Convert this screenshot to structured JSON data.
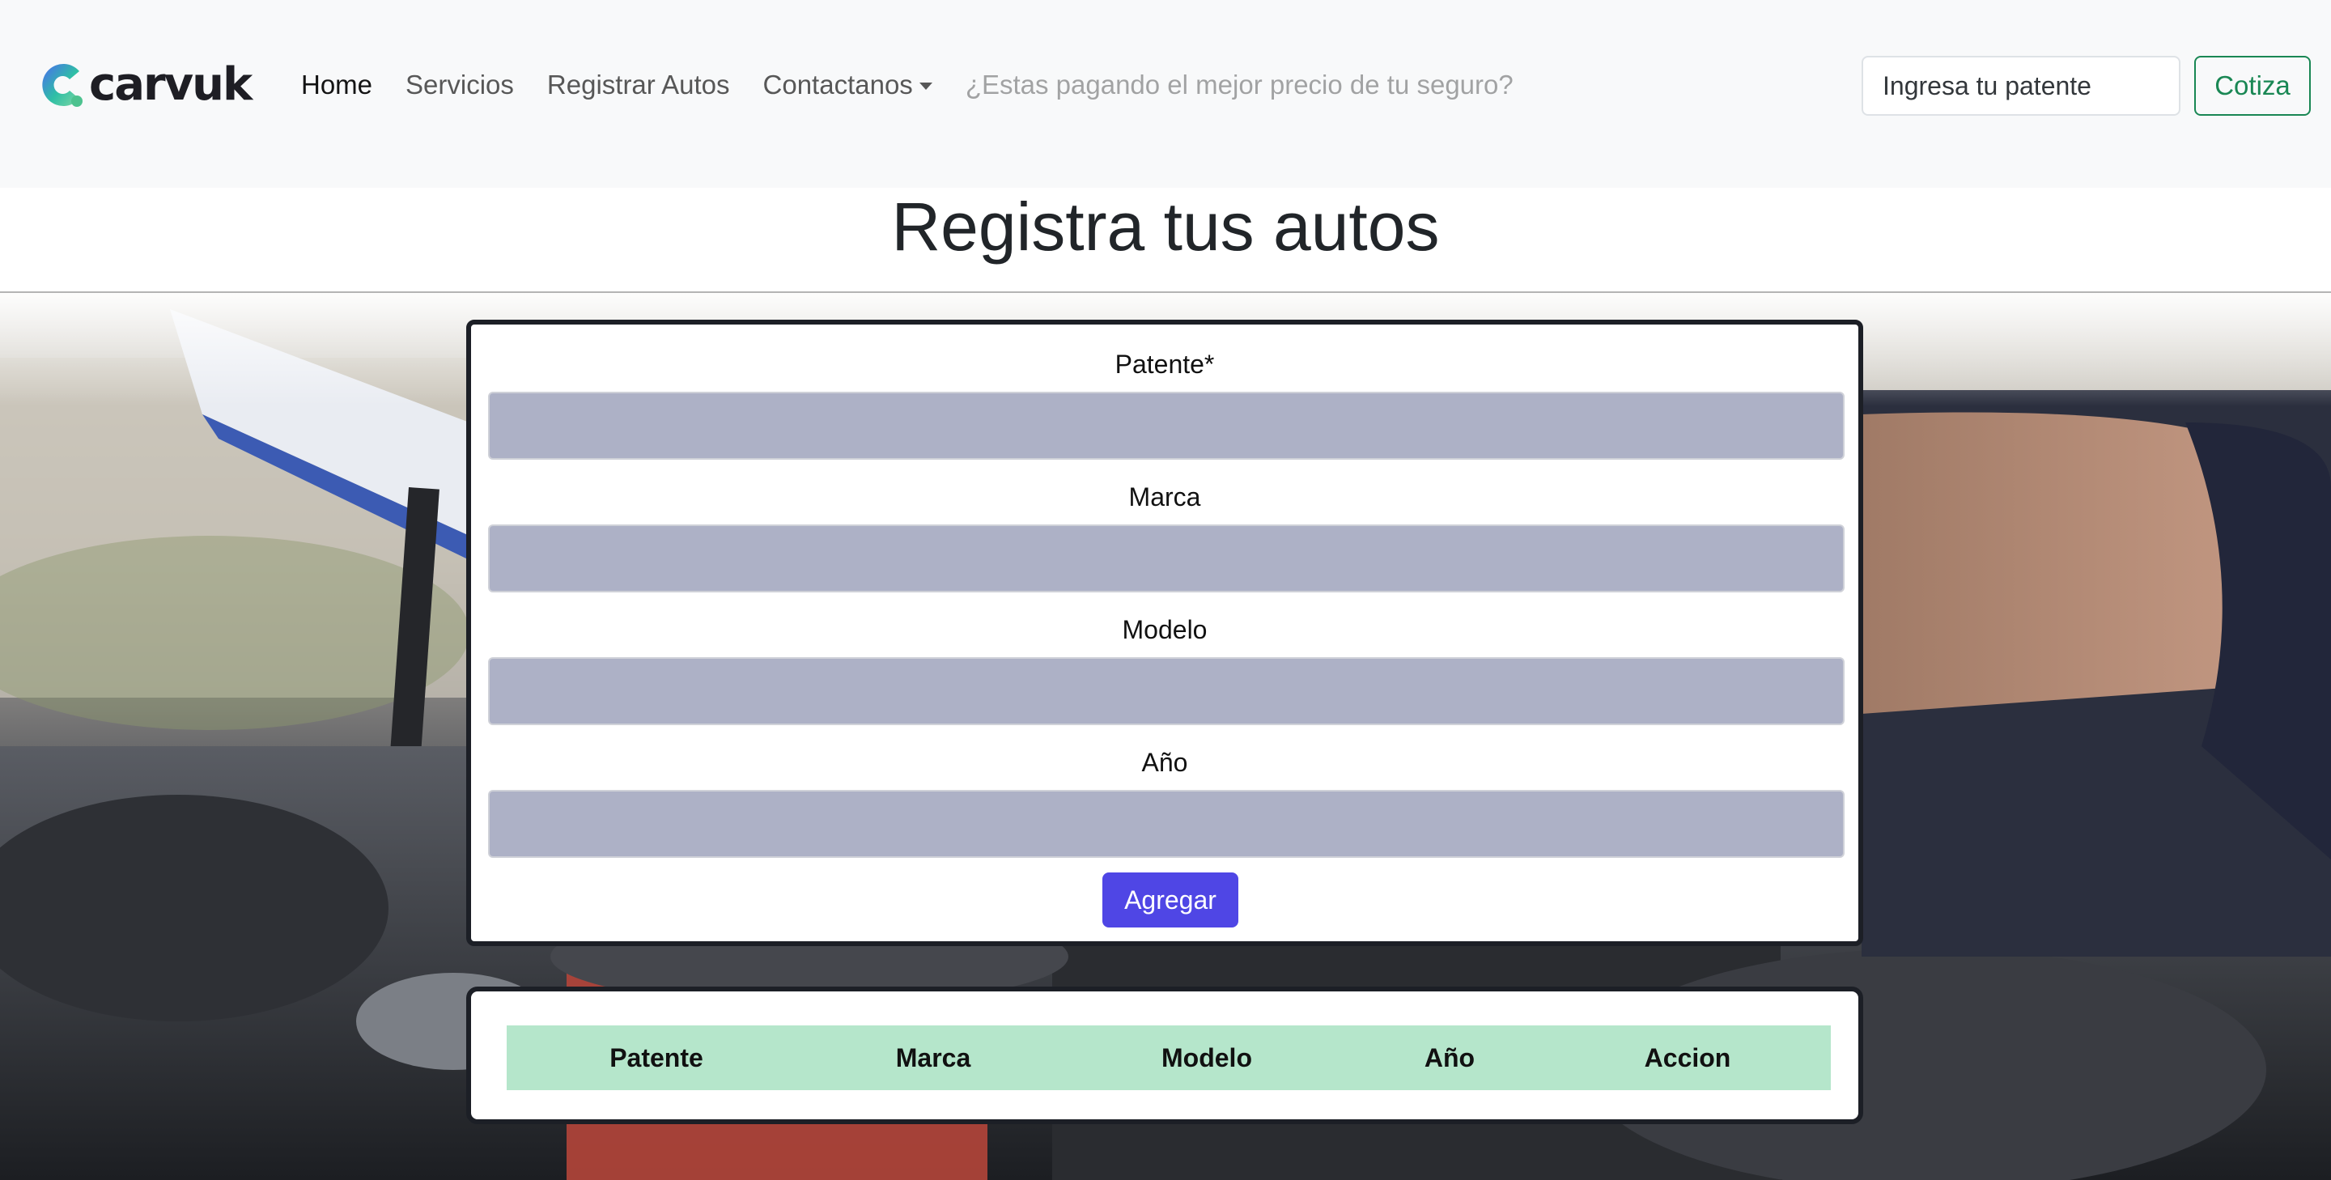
{
  "brand": {
    "name": "carvuk",
    "colors": {
      "mark_start": "#2fbfa5",
      "mark_end": "#4a6cf0",
      "dot": "#4dc28f"
    }
  },
  "nav": {
    "items": [
      {
        "label": "Home",
        "active": true
      },
      {
        "label": "Servicios",
        "active": false
      },
      {
        "label": "Registrar Autos",
        "active": false
      },
      {
        "label": "Contactanos",
        "active": false,
        "dropdown": true
      },
      {
        "label": "¿Estas pagando el mejor precio de tu seguro?",
        "disabled": true
      }
    ]
  },
  "search": {
    "placeholder": "Ingresa tu patente",
    "value": "",
    "button_label": "Cotiza"
  },
  "page": {
    "title": "Registra tus autos"
  },
  "form": {
    "fields": [
      {
        "label": "Patente*",
        "value": ""
      },
      {
        "label": "Marca",
        "value": ""
      },
      {
        "label": "Modelo",
        "value": ""
      },
      {
        "label": "Año",
        "value": ""
      }
    ],
    "submit_label": "Agregar",
    "colors": {
      "input_bg": "#adb1c6",
      "submit_bg": "#4f46e5"
    }
  },
  "table": {
    "columns": [
      "Patente",
      "Marca",
      "Modelo",
      "Año",
      "Accion"
    ],
    "rows": [],
    "colors": {
      "header_bg": "#b5e6cb"
    }
  },
  "icons": {
    "caret": "chevron-down-icon",
    "logo": "carvuk-logo-icon"
  }
}
